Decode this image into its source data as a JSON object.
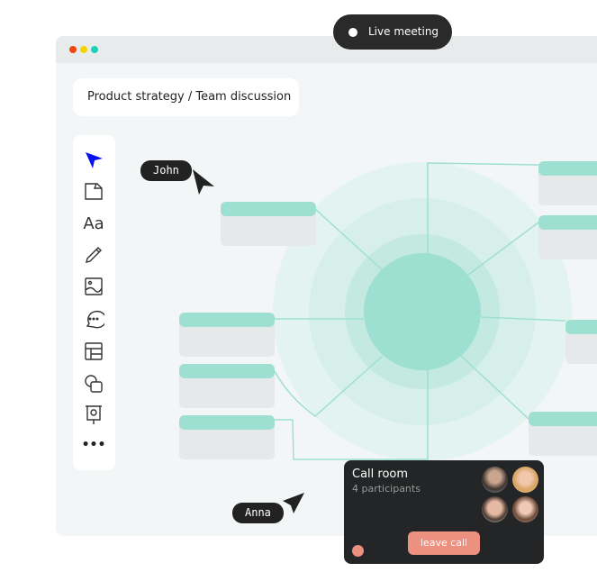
{
  "live_badge": {
    "label": "Live meeting"
  },
  "window": {
    "dots": [
      "#f0470e",
      "#f5d400",
      "#17d3b8"
    ]
  },
  "breadcrumb": "Product strategy / Team discussion",
  "toolbar": {
    "tools": [
      "cursor-icon",
      "sticky-note-icon",
      "text-icon",
      "pencil-icon",
      "image-icon",
      "comment-icon",
      "layout-icon",
      "shapes-icon",
      "presentation-icon",
      "more-icon"
    ],
    "active_color": "#0a10f0"
  },
  "cursors": {
    "john": "John",
    "anna": "Anna"
  },
  "call_room": {
    "title": "Call room",
    "participants": "4 participants",
    "leave_label": "leave call",
    "accent": "#ec9080"
  },
  "colors": {
    "teal": "#9de0d2",
    "card": "#e6e9ea"
  }
}
